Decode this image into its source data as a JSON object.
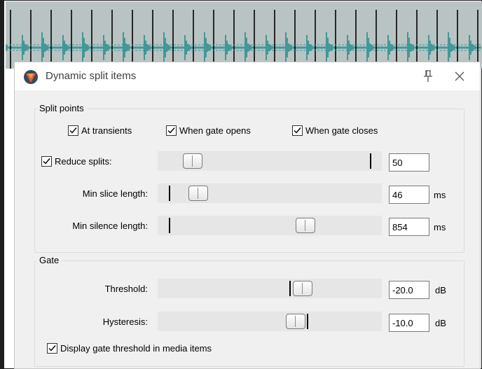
{
  "dialog": {
    "title": "Dynamic split items",
    "pin_icon": "pin-icon",
    "close_icon": "close-icon"
  },
  "split_points": {
    "label": "Split points",
    "at_transients": {
      "label": "At transients",
      "checked": true
    },
    "when_gate_opens": {
      "label": "When gate opens",
      "checked": true
    },
    "when_gate_closes": {
      "label": "When gate closes",
      "checked": true
    },
    "reduce_splits": {
      "label": "Reduce splits:",
      "checked": true,
      "value": "50"
    },
    "min_slice_length": {
      "label": "Min slice length:",
      "value": "46",
      "unit": "ms"
    },
    "min_silence_length": {
      "label": "Min silence length:",
      "value": "854",
      "unit": "ms"
    }
  },
  "gate": {
    "label": "Gate",
    "threshold": {
      "label": "Threshold:",
      "value": "-20.0",
      "unit": "dB"
    },
    "hysteresis": {
      "label": "Hysteresis:",
      "value": "-10.0",
      "unit": "dB"
    },
    "display_threshold": {
      "label": "Display gate threshold in media items",
      "checked": true
    }
  },
  "colors": {
    "waveform": "#2a8a8a",
    "waveform_bg": "#b9c3c3",
    "dialog_bg": "#f0f0f0",
    "reaper_icon": "#e0603a"
  }
}
